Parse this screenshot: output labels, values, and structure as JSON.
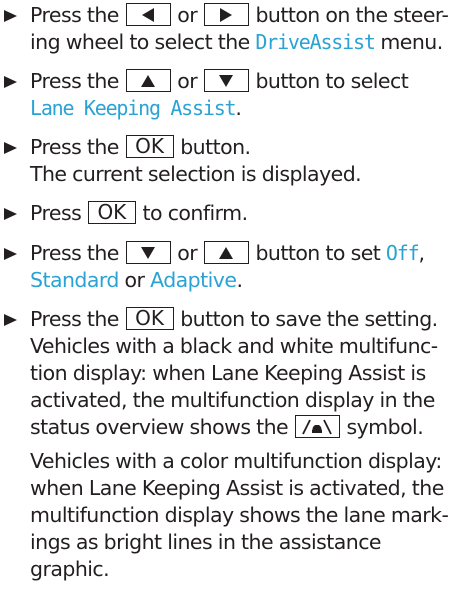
{
  "steps": [
    {
      "line1_a": "Press the",
      "or": "or",
      "line1_b": "button on the steer-",
      "line2_a": "ing wheel to select the",
      "menu": "DriveAssist",
      "line2_b": "menu."
    },
    {
      "line1_a": "Press the",
      "or": "or",
      "line1_b": "button to select",
      "feature": "Lane Keeping Assist",
      "period": "."
    },
    {
      "line1_a": "Press the",
      "key": "OK",
      "line1_b": "button.",
      "line2": "The current selection is displayed."
    },
    {
      "line1_a": "Press",
      "key": "OK",
      "line1_b": "to confirm."
    },
    {
      "line1_a": "Press the",
      "or": "or",
      "line1_b": "button to set",
      "opt_off": "Off",
      "comma": ",",
      "opt_standard": "Standard",
      "or2": "or",
      "opt_adaptive": "Adaptive",
      "period": "."
    },
    {
      "line1_a": "Press the",
      "key": "OK",
      "line1_b": "button to save the setting.",
      "p1_l1": "Vehicles with a black and white multifunc-",
      "p1_l2": "tion display: when Lane Keeping Assist is",
      "p1_l3": "activated, the multifunction display in the",
      "p1_l4a": "status overview shows the",
      "p1_l4b": "symbol."
    }
  ],
  "note": {
    "l1": "Vehicles with a color multifunction display:",
    "l2": "when Lane Keeping Assist is activated, the",
    "l3": "multifunction display shows the lane mark-",
    "l4": "ings as bright lines in the assistance",
    "l5": "graphic."
  },
  "icons": {
    "bullet": "triangle-right",
    "left": "left-arrow",
    "right": "right-arrow",
    "up": "up-arrow",
    "down": "down-arrow",
    "lane": "lane-keeping-symbol"
  },
  "colors": {
    "text": "#231f20",
    "highlight": "#2aa3d4"
  }
}
